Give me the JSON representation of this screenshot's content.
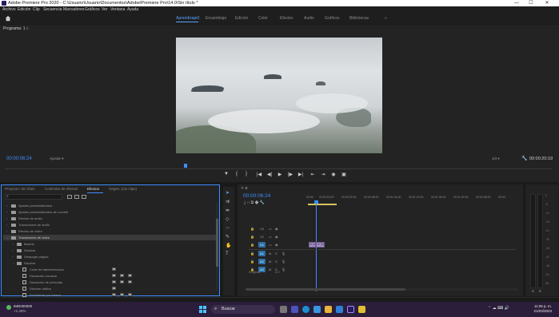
{
  "window": {
    "title": "Adobe Premiere Pro 2020 - C:\\Usuario\\Usuario\\Documentos\\Adobe\\Premiere Pro\\14.0\\Sin título *",
    "controls": [
      "—",
      "☐",
      "✕"
    ]
  },
  "menu": [
    "Archivo",
    "Edición",
    "Clip",
    "Secuencia",
    "Marcadores",
    "Gráficos",
    "Ver",
    "Ventana",
    "Ayuda"
  ],
  "workspaces": {
    "tabs": [
      "Aprendizaje",
      "Ensamblaje",
      "Edición",
      "Color",
      "Efectos",
      "Audio",
      "Gráficos",
      "Bibliotecas"
    ],
    "active": "Aprendizaje",
    "more": "»"
  },
  "program_monitor": {
    "tab": "Programa: 1",
    "timecode": "00:00:06:24",
    "fit": "Ajustar",
    "quality": "1/4",
    "duration": "00:00:20:19"
  },
  "transport": [
    "▼",
    "{",
    "}",
    "|◀",
    "◀|",
    "▶",
    "|▶",
    "▶|",
    "⇤",
    "⇥",
    "◉",
    "▣"
  ],
  "effects_panel": {
    "tabs": [
      "Proyecto: Sin título",
      "Controles de efectos",
      "Efectos",
      "Origen: (sin clips)"
    ],
    "active_tab": "Efectos",
    "search_placeholder": "",
    "items": [
      {
        "label": "Ajustes preestablecidos",
        "level": 0,
        "type": "folder",
        "expanded": false
      },
      {
        "label": "Ajustes preestablecidos de Lumetri",
        "level": 0,
        "type": "folder",
        "expanded": false
      },
      {
        "label": "Efectos de audio",
        "level": 0,
        "type": "folder",
        "expanded": false
      },
      {
        "label": "Transiciones de audio",
        "level": 0,
        "type": "folder",
        "expanded": false
      },
      {
        "label": "Efectos de vídeo",
        "level": 0,
        "type": "folder",
        "expanded": false
      },
      {
        "label": "Transiciones de vídeo",
        "level": 0,
        "type": "folder",
        "expanded": true,
        "selected": true
      },
      {
        "label": "Barrido",
        "level": 1,
        "type": "folder",
        "expanded": false
      },
      {
        "label": "Deslizar",
        "level": 1,
        "type": "folder",
        "expanded": false
      },
      {
        "label": "Despegar página",
        "level": 1,
        "type": "folder",
        "expanded": false
      },
      {
        "label": "Disolver",
        "level": 1,
        "type": "folder",
        "expanded": true
      },
      {
        "label": "Corte de transformación",
        "level": 2,
        "type": "effect",
        "badges": 1
      },
      {
        "label": "Disolución cruzada",
        "level": 2,
        "type": "effect",
        "badges": 3
      },
      {
        "label": "Disolución de películas",
        "level": 2,
        "type": "effect",
        "badges": 3
      },
      {
        "label": "Disolver aditivo",
        "level": 2,
        "type": "effect",
        "badges": 1
      },
      {
        "label": "Encadenar por blanco",
        "level": 2,
        "type": "effect",
        "badges": 3
      }
    ]
  },
  "timeline": {
    "tab": "≡",
    "timecode": "00:00:06:24",
    "ruler_labels": [
      "00:00",
      "00:00:16:00",
      "00:00:32:00",
      "00:00:48:00",
      "00:01:04:00",
      "00:01:20:00",
      "00:01:36:00",
      "00:01:52:00",
      "00:02:08:00",
      "00:02:"
    ],
    "video_tracks": [
      "V3",
      "V2",
      "V1"
    ],
    "audio_tracks": [
      "A1",
      "A2",
      "A3"
    ],
    "master": "Original",
    "master_value": "0.0",
    "clips": [
      {
        "label": "fx [V]",
        "track": "V1",
        "start_sec": 0.5,
        "end_sec": 10.2
      },
      {
        "label": "fx [V]",
        "track": "V1",
        "start_sec": 10.2,
        "end_sec": 20.8
      }
    ]
  },
  "audio_meters": {
    "ticks": [
      "0",
      "-6",
      "-12",
      "-18",
      "-24",
      "-30",
      "-36",
      "-42",
      "-48",
      "-54",
      "dB"
    ],
    "solo": [
      "S",
      "S"
    ]
  },
  "taskbar": {
    "weather_temp": "IMD000000",
    "weather_desc": "+1.40%",
    "search_label": "Buscar",
    "time": "11:05 p. m.",
    "date": "21/03/2023",
    "tray": "⌃ ☁ ⌨ 🔊"
  }
}
